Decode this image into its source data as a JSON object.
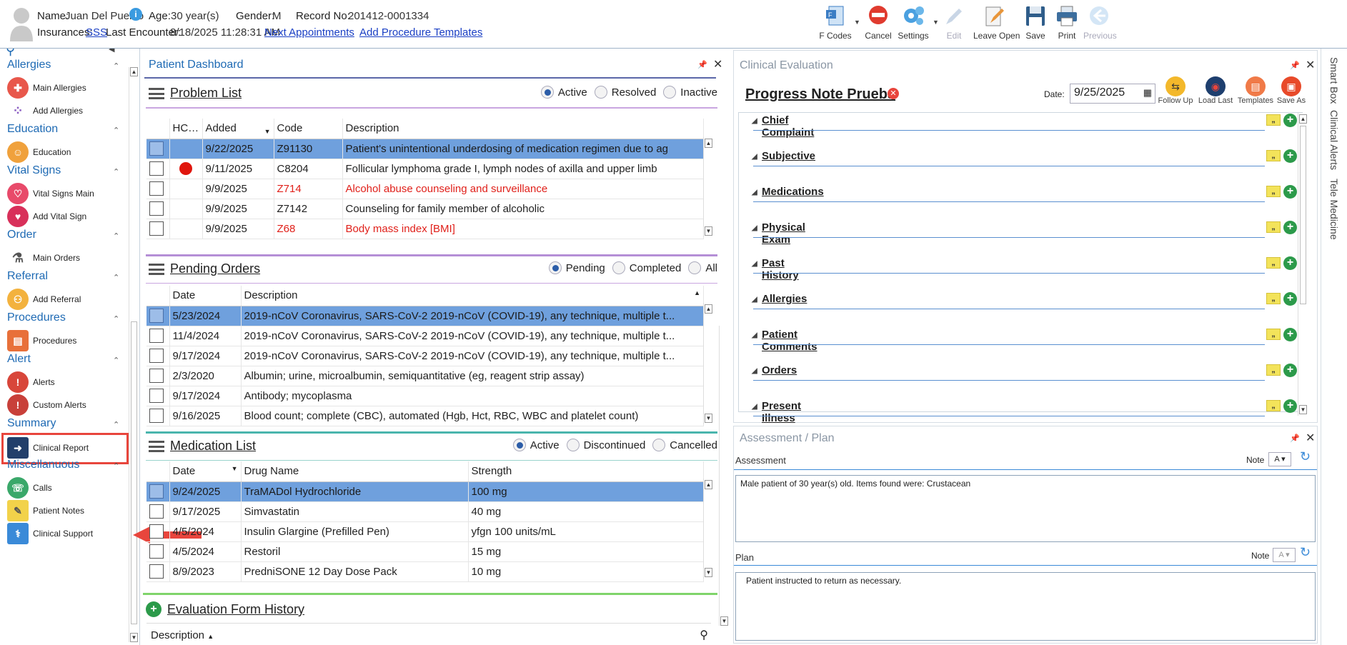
{
  "header": {
    "name_label": "Name:",
    "name_value": "Juan Del Pueblo",
    "age_label": "Age:",
    "age_value": "30 year(s)",
    "gender_label": "Gender:",
    "gender_value": "M",
    "record_label": "Record No:",
    "record_value": "201412-0001334",
    "insurances_label": "Insurances:",
    "insurances_value": "SSS",
    "last_enc_label": "Last Encounter:",
    "last_enc_value": "8/18/2025 11:28:31 AM",
    "next_appts": "Next Appointments",
    "add_proc_templates": "Add Procedure Templates"
  },
  "toolbar": {
    "fcodes": "F Codes",
    "cancel": "Cancel",
    "settings": "Settings",
    "edit": "Edit",
    "leave_open": "Leave Open",
    "save": "Save",
    "print": "Print",
    "previous": "Previous"
  },
  "sidebar": {
    "sections": [
      {
        "title": "Allergies",
        "items": [
          "Main Allergies",
          "Add Allergies"
        ]
      },
      {
        "title": "Education",
        "items": [
          "Education"
        ]
      },
      {
        "title": "Vital Signs",
        "items": [
          "Vital Signs Main",
          "Add Vital Sign"
        ]
      },
      {
        "title": "Order",
        "items": [
          "Main Orders"
        ]
      },
      {
        "title": "Referral",
        "items": [
          "Add Referral"
        ]
      },
      {
        "title": "Procedures",
        "items": [
          "Procedures"
        ]
      },
      {
        "title": "Alert",
        "items": [
          "Alerts",
          "Custom Alerts"
        ]
      },
      {
        "title": "Summary",
        "items": [
          "Clinical Report"
        ]
      },
      {
        "title": "Miscellanuous",
        "items": [
          "Calls",
          "Patient Notes",
          "Clinical Support"
        ]
      }
    ]
  },
  "dashboard": {
    "title": "Patient Dashboard",
    "problem_list": {
      "title": "Problem List",
      "filters": [
        "Active",
        "Resolved",
        "Inactive"
      ],
      "selected_filter": "Active",
      "columns": [
        "HCC",
        "Added",
        "Code",
        "Description"
      ],
      "rows": [
        {
          "hcc": "",
          "added": "9/22/2025",
          "code": "Z91130",
          "desc": "Patient's unintentional underdosing of medication regimen due to ag"
        },
        {
          "hcc": "red-dot",
          "added": "9/11/2025",
          "code": "C8204",
          "desc": "Follicular lymphoma grade I, lymph nodes of axilla and upper limb"
        },
        {
          "hcc": "",
          "added": "9/9/2025",
          "code": "Z714",
          "desc": "Alcohol abuse counseling and surveillance"
        },
        {
          "hcc": "",
          "added": "9/9/2025",
          "code": "Z7142",
          "desc": "Counseling for family member of alcoholic"
        },
        {
          "hcc": "",
          "added": "9/9/2025",
          "code": "Z68",
          "desc": "Body mass index [BMI]"
        }
      ]
    },
    "pending_orders": {
      "title": "Pending Orders",
      "filters": [
        "Pending",
        "Completed",
        "All"
      ],
      "selected_filter": "Pending",
      "columns": [
        "Date",
        "Description"
      ],
      "rows": [
        {
          "date": "5/23/2024",
          "desc": "2019-nCoV Coronavirus, SARS-CoV-2 2019-nCoV (COVID-19), any technique, multiple t..."
        },
        {
          "date": "11/4/2024",
          "desc": "2019-nCoV Coronavirus, SARS-CoV-2 2019-nCoV (COVID-19), any technique, multiple t..."
        },
        {
          "date": "9/17/2024",
          "desc": "2019-nCoV Coronavirus, SARS-CoV-2 2019-nCoV (COVID-19), any technique, multiple t..."
        },
        {
          "date": "2/3/2020",
          "desc": "Albumin; urine, microalbumin, semiquantitative (eg, reagent strip assay)"
        },
        {
          "date": "9/17/2024",
          "desc": "Antibody; mycoplasma"
        },
        {
          "date": "9/16/2025",
          "desc": "Blood count; complete (CBC), automated (Hgb, Hct, RBC, WBC and platelet count)"
        }
      ]
    },
    "medication_list": {
      "title": "Medication List",
      "filters": [
        "Active",
        "Discontinued",
        "Cancelled"
      ],
      "selected_filter": "Active",
      "columns": [
        "Date",
        "Drug Name",
        "Strength"
      ],
      "rows": [
        {
          "date": "9/24/2025",
          "drug": "TraMADol Hydrochloride",
          "strength": "100 mg"
        },
        {
          "date": "9/17/2025",
          "drug": "Simvastatin",
          "strength": "40 mg"
        },
        {
          "date": "4/5/2024",
          "drug": "Insulin Glargine (Prefilled Pen)",
          "strength": "yfgn 100 units/mL"
        },
        {
          "date": "4/5/2024",
          "drug": "Restoril",
          "strength": "15 mg"
        },
        {
          "date": "8/9/2023",
          "drug": "PredniSONE 12 Day Dose Pack",
          "strength": "10 mg"
        }
      ]
    },
    "eval_history": {
      "title": "Evaluation Form History",
      "column": "Description"
    }
  },
  "clinical_eval": {
    "title": "Clinical Evaluation",
    "note_title": "Progress Note Prueba",
    "date_label": "Date:",
    "date_value": "9/25/2025",
    "actions": [
      "Follow Up",
      "Load Last",
      "Templates",
      "Save As"
    ],
    "sections": [
      "Chief Complaint",
      "Subjective",
      "Medications",
      "Physical Exam",
      "Past History",
      "Allergies",
      "Patient Comments",
      "Orders",
      "Present Illness"
    ]
  },
  "assessment_plan": {
    "title": "Assessment / Plan",
    "assessment_label": "Assessment",
    "plan_label": "Plan",
    "note_label": "Note",
    "assessment_text": "Male patient of 30 year(s) old. Items found were:  Crustacean",
    "plan_text": "Patient instructed to return as necessary."
  },
  "right_tabs": [
    "Smart Box",
    "Clinical Alerts",
    "Tele Medicine"
  ],
  "colors": {
    "accent": "#1e6ab4",
    "selected_row": "#6fa0dd",
    "highlight": "#e8453c"
  }
}
